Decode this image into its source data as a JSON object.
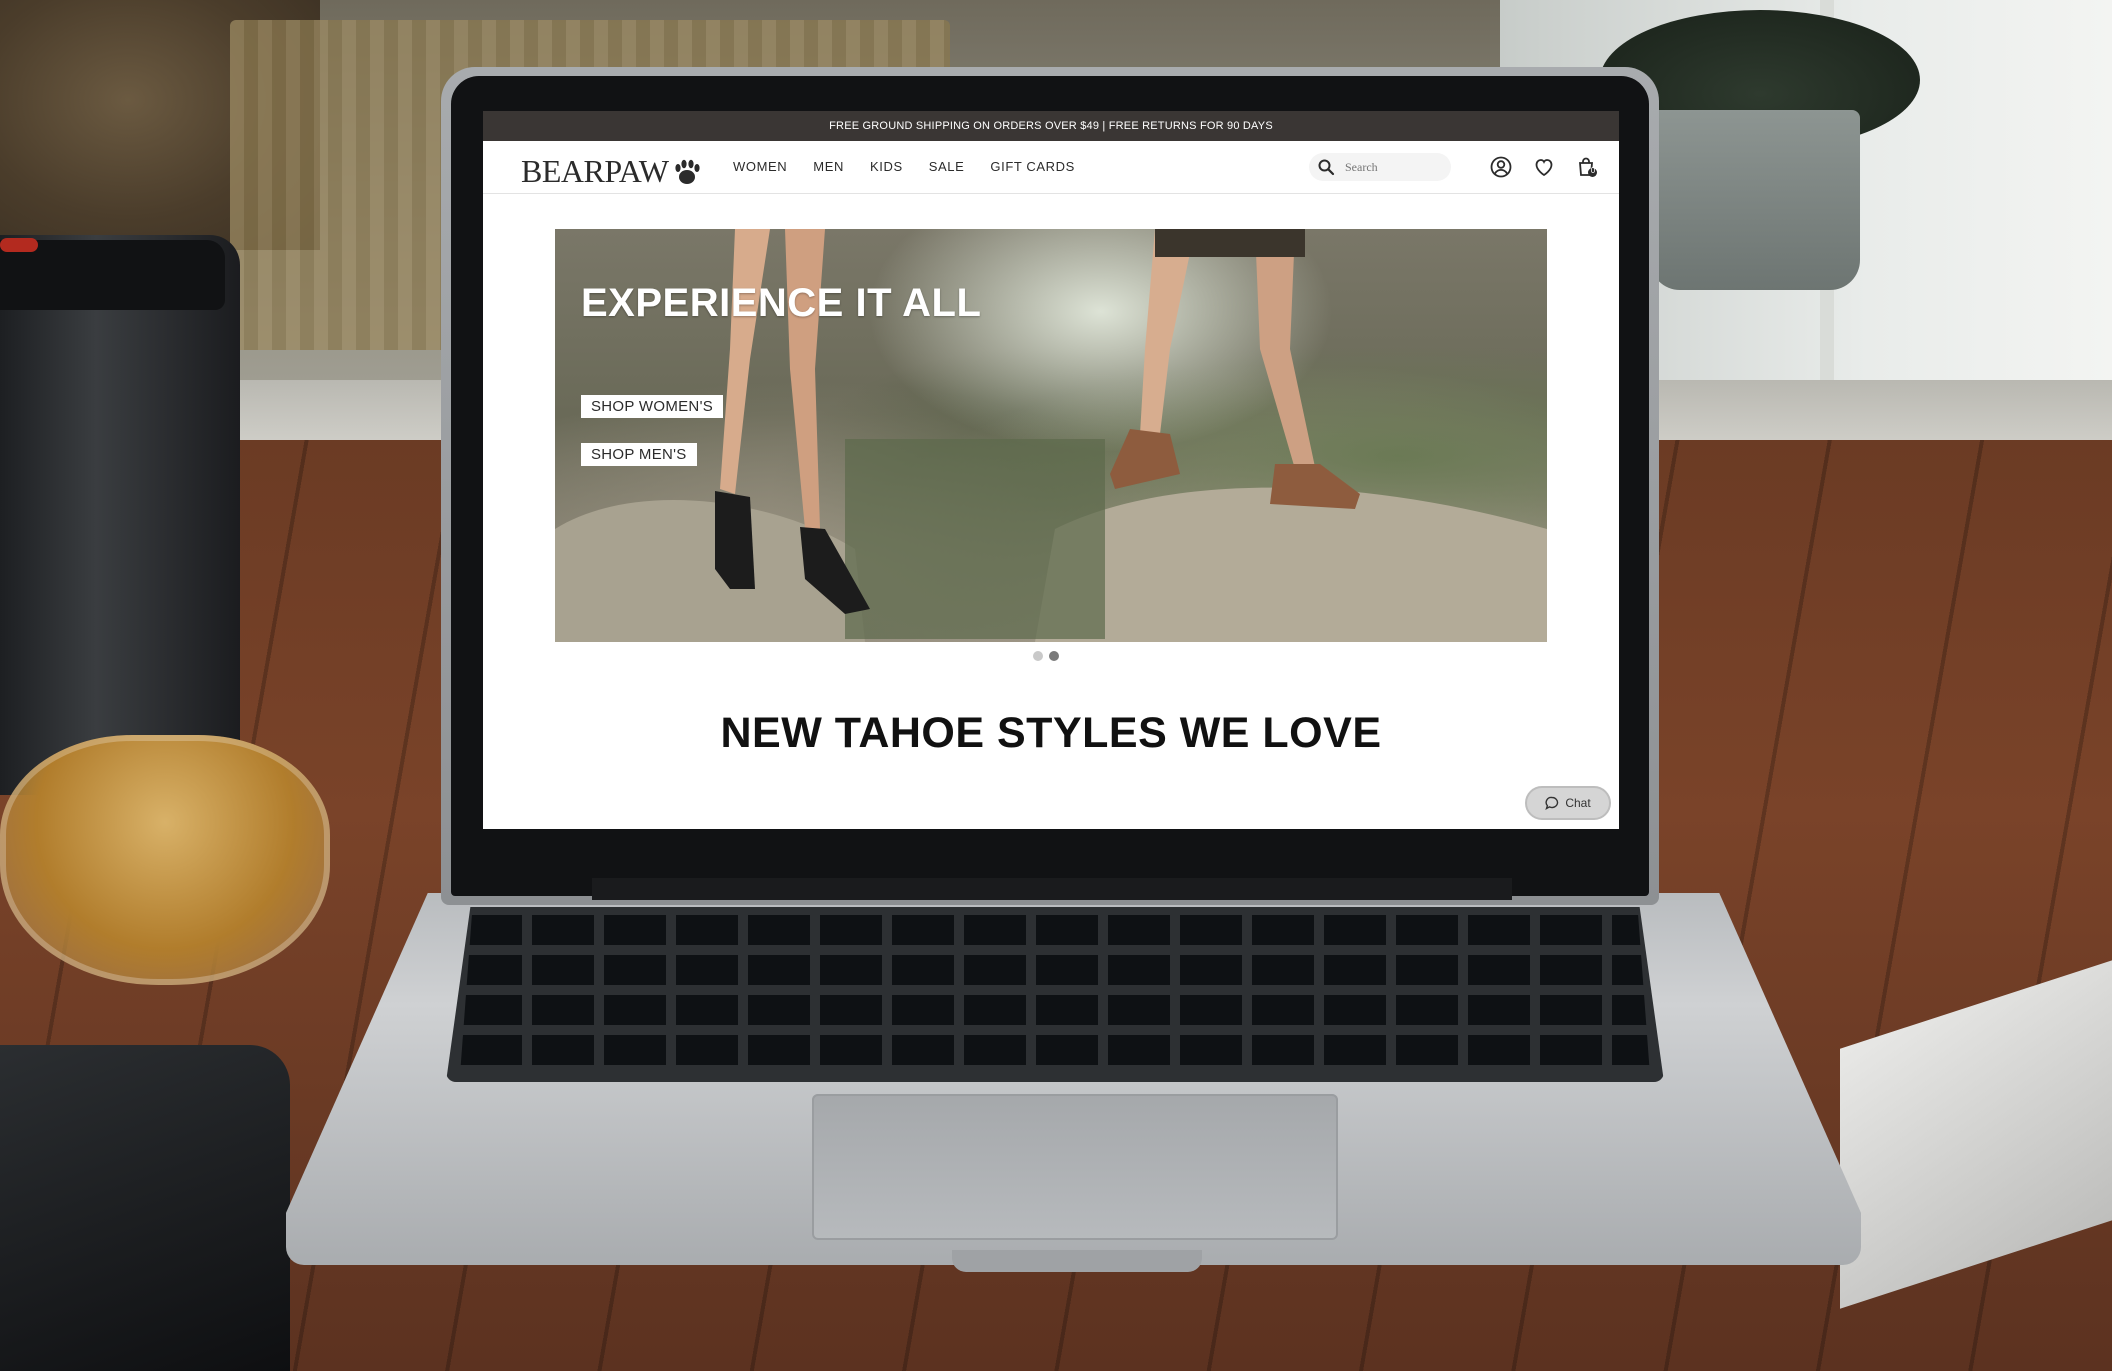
{
  "promo_bar": {
    "text": "FREE GROUND SHIPPING ON ORDERS OVER $49  |  FREE RETURNS FOR 90 DAYS"
  },
  "header": {
    "logo_text": "BEARPAW",
    "nav": [
      {
        "label": "WOMEN"
      },
      {
        "label": "MEN"
      },
      {
        "label": "KIDS"
      },
      {
        "label": "SALE"
      },
      {
        "label": "GIFT CARDS"
      }
    ],
    "search": {
      "placeholder": "Search",
      "icon": "search-icon"
    },
    "icons": [
      "account-icon",
      "heart-icon",
      "cart-icon"
    ],
    "cart_count": "0"
  },
  "hero": {
    "title": "EXPERIENCE IT ALL",
    "buttons": [
      {
        "label": "SHOP WOMEN'S"
      },
      {
        "label": "SHOP MEN'S"
      }
    ],
    "slides": 2,
    "active_slide": 2
  },
  "section": {
    "title": "NEW TAHOE STYLES WE LOVE"
  },
  "chat": {
    "label": "Chat",
    "icon": "chat-bubble-icon"
  },
  "colors": {
    "promo_bg": "#3a3634",
    "text": "#2b2b2b",
    "chat_bg": "#d5d5d5"
  }
}
